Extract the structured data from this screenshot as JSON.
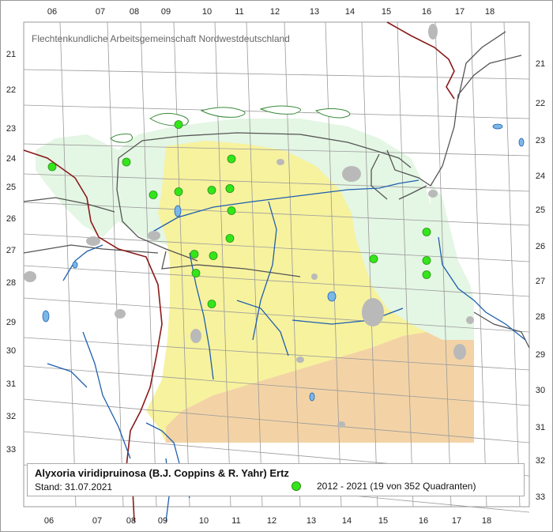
{
  "header": "Flechtenkundliche Arbeitsgemeinschaft Nordwestdeutschland",
  "x_ticks": [
    "06",
    "07",
    "08",
    "09",
    "10",
    "11",
    "12",
    "13",
    "14",
    "15",
    "16",
    "17",
    "18"
  ],
  "y_ticks_left": [
    "21",
    "22",
    "23",
    "24",
    "25",
    "26",
    "27",
    "28",
    "29",
    "30",
    "31",
    "32",
    "33"
  ],
  "y_ticks_right": [
    "21",
    "22",
    "23",
    "24",
    "25",
    "26",
    "27",
    "28",
    "29",
    "30",
    "31",
    "32",
    "33"
  ],
  "legend": {
    "species": "Alyxoria viridipruinosa (B.J. Coppins & R. Yahr) Ertz",
    "stand": "Stand: 31.07.2021",
    "range_label": "2012 - 2021 (19 von 352 Quadranten)"
  },
  "colors": {
    "record_dot": "#33e61a",
    "coast_zone": "#e4f6e4",
    "geest_zone": "#f7f29e",
    "south_zone": "#f3d3a6",
    "water": "#1f5fae",
    "border": "#8b1a1a",
    "urban": "#b9b9b9"
  },
  "records": [
    {
      "col": "06",
      "row": "24"
    },
    {
      "col": "08",
      "row": "24"
    },
    {
      "col": "09",
      "row": "23"
    },
    {
      "col": "09",
      "row": "25"
    },
    {
      "col": "09",
      "row": "25"
    },
    {
      "col": "10",
      "row": "25"
    },
    {
      "col": "11",
      "row": "25"
    },
    {
      "col": "11",
      "row": "24"
    },
    {
      "col": "11",
      "row": "25"
    },
    {
      "col": "11",
      "row": "25"
    },
    {
      "col": "11",
      "row": "26"
    },
    {
      "col": "10",
      "row": "27"
    },
    {
      "col": "10",
      "row": "27"
    },
    {
      "col": "10",
      "row": "27"
    },
    {
      "col": "10",
      "row": "28"
    },
    {
      "col": "15",
      "row": "27"
    },
    {
      "col": "16",
      "row": "26"
    },
    {
      "col": "16",
      "row": "27"
    },
    {
      "col": "16",
      "row": "27"
    }
  ]
}
